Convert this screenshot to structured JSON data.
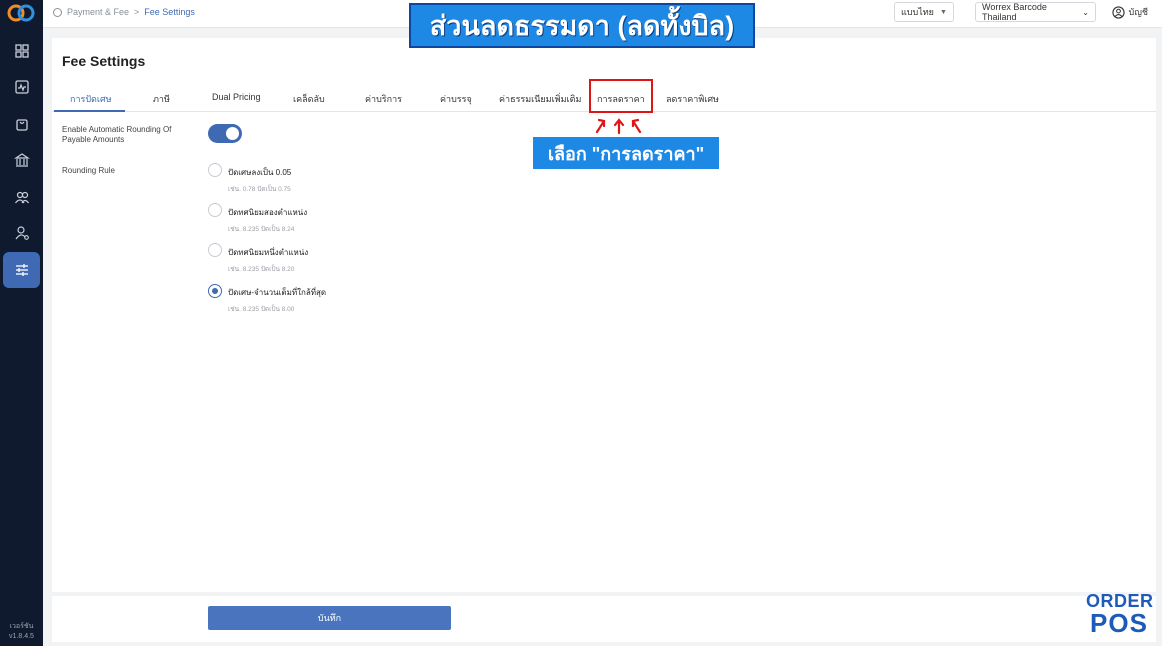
{
  "app": {
    "logo": "orderpos-logo",
    "version_label": "เวอร์ชัน",
    "version_number": "v1.8.4.5"
  },
  "sidebar": {
    "items": [
      {
        "icon": "grid-icon",
        "active": false
      },
      {
        "icon": "activity-icon",
        "active": false
      },
      {
        "icon": "bag-icon",
        "active": false
      },
      {
        "icon": "bank-icon",
        "active": false
      },
      {
        "icon": "users-icon",
        "active": false
      },
      {
        "icon": "user-settings-icon",
        "active": false
      },
      {
        "icon": "sliders-icon",
        "active": true
      }
    ]
  },
  "breadcrumb": {
    "parent": "Payment & Fee",
    "separator": ">",
    "current": "Fee Settings"
  },
  "header": {
    "language": "แบบไทย",
    "store": "Worrex Barcode Thailand",
    "account": "บัญชี"
  },
  "page": {
    "title": "Fee Settings",
    "tabs": [
      {
        "label": "การปัดเศษ",
        "active": true
      },
      {
        "label": "ภาษี",
        "active": false
      },
      {
        "label": "Dual Pricing",
        "active": false
      },
      {
        "label": "เคล็ดลับ",
        "active": false
      },
      {
        "label": "ค่าบริการ",
        "active": false
      },
      {
        "label": "ค่าบรรจุ",
        "active": false
      },
      {
        "label": "ค่าธรรมเนียมเพิ่มเติม",
        "active": false
      },
      {
        "label": "การลดราคา",
        "active": false
      },
      {
        "label": "ลดราคาพิเศษ",
        "active": false
      }
    ],
    "auto_rounding_label": "Enable Automatic Rounding Of Payable Amounts",
    "auto_rounding_enabled": true,
    "rounding_rule_label": "Rounding Rule",
    "rounding_options": [
      {
        "label": "ปัดเศษลงเป็น 0.05",
        "hint": "เช่น. 0.78 ปัดเป็น 0.75",
        "checked": false
      },
      {
        "label": "ปัดทศนิยมสองตำแหน่ง",
        "hint": "เช่น. 8.235 ปัดเป็น 8.24",
        "checked": false
      },
      {
        "label": "ปัดทศนิยมหนึ่งตำแหน่ง",
        "hint": "เช่น. 8.235 ปัดเป็น 8.20",
        "checked": false
      },
      {
        "label": "ปัดเศษ-จำนวนเต็มที่ใกล้ที่สุด",
        "hint": "เช่น. 8.235 ปัดเป็น 8.00",
        "checked": true
      }
    ],
    "save_label": "บันทึก"
  },
  "overlay": {
    "banner": "ส่วนลดธรรมดา (ลดทั้งบิล)",
    "callout": "เลือก \"การลดราคา\"",
    "brand_top": "ORDER",
    "brand_bottom": "POS"
  },
  "colors": {
    "accent": "#3f6ab3",
    "sidebar": "#0f1a2e",
    "banner": "#1e88e5",
    "highlight": "#e01616"
  }
}
